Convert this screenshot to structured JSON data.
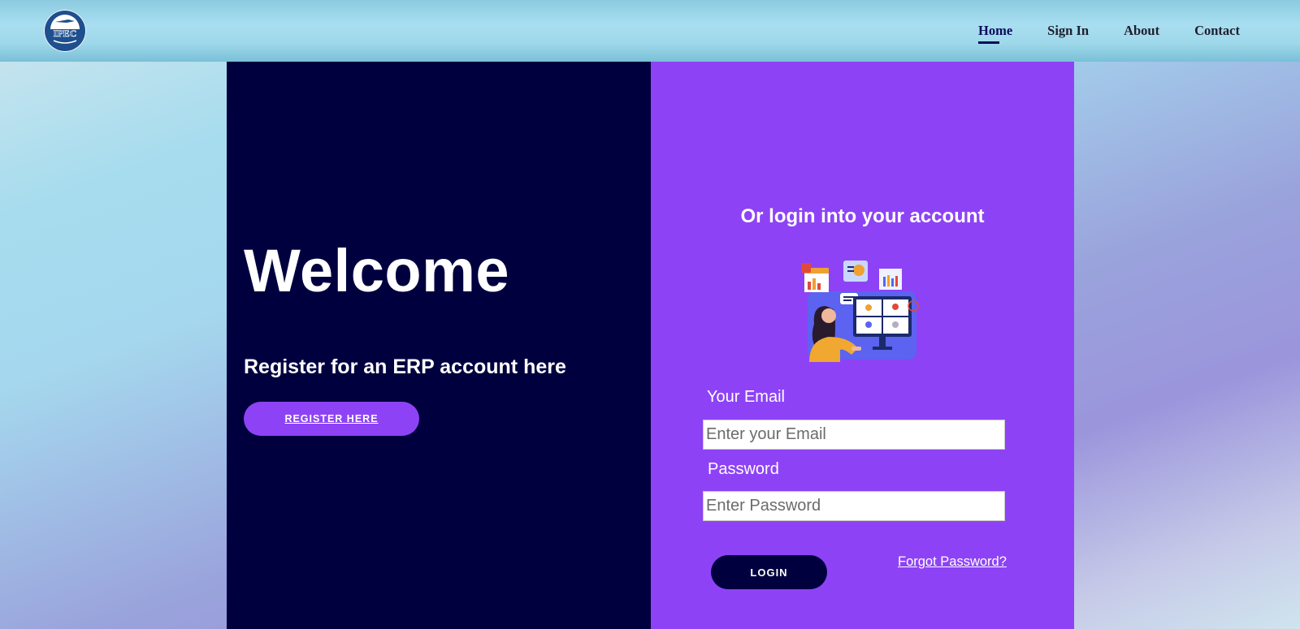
{
  "header": {
    "logo_text": "IPEC",
    "nav": [
      {
        "label": "Home",
        "active": true
      },
      {
        "label": "Sign In",
        "active": false
      },
      {
        "label": "About",
        "active": false
      },
      {
        "label": "Contact",
        "active": false
      }
    ]
  },
  "left": {
    "welcome": "Welcome",
    "register_text": "Register for an ERP account here",
    "register_button": "REGISTER HERE"
  },
  "right": {
    "title": "Or login into your account",
    "illustration_icon": "video-conference-illustration",
    "email_label": "Your Email",
    "email_placeholder": "Enter your Email",
    "email_value": "",
    "password_label": "Password",
    "password_placeholder": "Enter Password",
    "password_value": "",
    "login_button": "LOGIN",
    "forgot_link": "Forgot Password?"
  },
  "colors": {
    "left_panel": "#00003f",
    "right_panel": "#8d43f5",
    "accent": "#8d43f5"
  }
}
